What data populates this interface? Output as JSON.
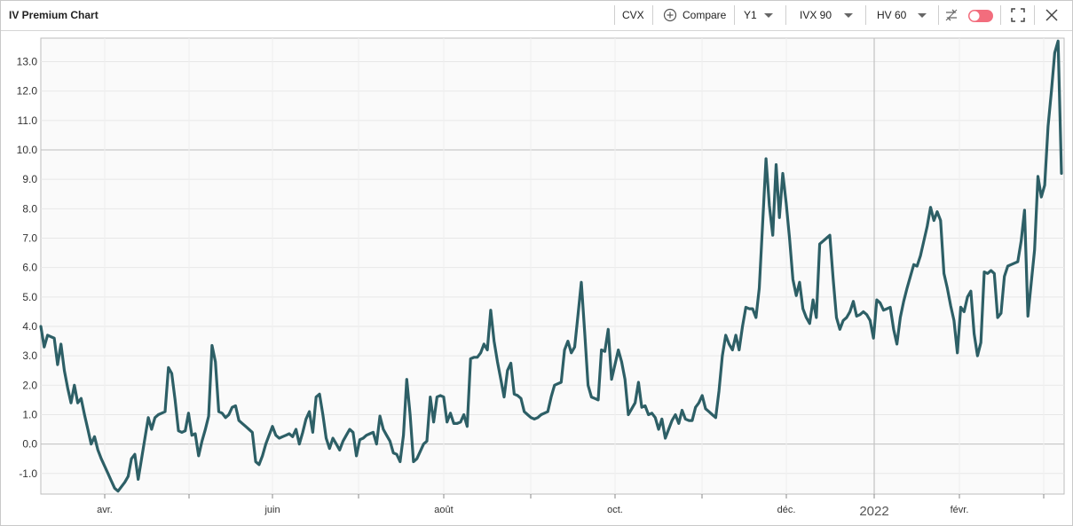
{
  "window": {
    "title": "IV Premium Chart"
  },
  "toolbar": {
    "symbol": "CVX",
    "compare_label": "Compare",
    "period": "Y1",
    "iv_measure": "IVX 90",
    "hv_measure": "HV 60",
    "toggle_color": "#f26d7d",
    "icons": [
      "plus-circle-icon",
      "chevron-down-icon",
      "swap-icon",
      "toggle-icon",
      "fullscreen-icon",
      "close-icon"
    ]
  },
  "chart_data": {
    "type": "line",
    "title": "",
    "xlabel": "",
    "ylabel": "",
    "ylim": [
      -1.7,
      13.8
    ],
    "grid": true,
    "x_tick_labels": [
      "avr.",
      "juin",
      "août",
      "oct.",
      "déc.",
      "2022",
      "févr."
    ],
    "y_tick_labels": [
      "-1.0",
      "0.0",
      "1.0",
      "2.0",
      "3.0",
      "4.0",
      "5.0",
      "6.0",
      "7.0",
      "8.0",
      "9.0",
      "10.0",
      "11.0",
      "12.0",
      "13.0"
    ],
    "series": [
      {
        "color": "#2d5f66",
        "values": [
          4.0,
          3.3,
          3.7,
          3.65,
          3.6,
          2.7,
          3.4,
          2.5,
          1.9,
          1.4,
          2.0,
          1.4,
          1.55,
          1.0,
          0.5,
          0.0,
          0.25,
          -0.2,
          -0.5,
          -0.75,
          -1.0,
          -1.25,
          -1.5,
          -1.6,
          -1.45,
          -1.3,
          -1.1,
          -0.5,
          -0.35,
          -1.2,
          -0.5,
          0.2,
          0.9,
          0.5,
          0.9,
          1.0,
          1.05,
          1.1,
          2.6,
          2.4,
          1.5,
          0.45,
          0.4,
          0.45,
          1.05,
          0.3,
          0.35,
          -0.4,
          0.1,
          0.5,
          0.95,
          3.35,
          2.8,
          1.1,
          1.05,
          0.9,
          1.0,
          1.25,
          1.3,
          0.8,
          0.7,
          0.6,
          0.5,
          0.4,
          -0.6,
          -0.7,
          -0.4,
          0.0,
          0.3,
          0.6,
          0.3,
          0.2,
          0.25,
          0.3,
          0.35,
          0.25,
          0.5,
          0.0,
          0.4,
          0.85,
          1.1,
          0.4,
          1.6,
          1.7,
          1.0,
          0.2,
          -0.15,
          0.2,
          0.0,
          -0.2,
          0.1,
          0.3,
          0.5,
          0.4,
          -0.4,
          0.15,
          0.2,
          0.3,
          0.35,
          0.4,
          0.0,
          0.95,
          0.5,
          0.3,
          0.1,
          -0.3,
          -0.35,
          -0.6,
          0.3,
          2.2,
          1.0,
          -0.6,
          -0.5,
          -0.25,
          0.0,
          0.1,
          1.6,
          0.75,
          1.6,
          1.65,
          1.6,
          0.75,
          1.05,
          0.7,
          0.7,
          0.75,
          1.0,
          0.6,
          2.9,
          2.95,
          2.95,
          3.1,
          3.4,
          3.2,
          4.55,
          3.5,
          2.8,
          2.2,
          1.6,
          2.5,
          2.75,
          1.7,
          1.65,
          1.55,
          1.1,
          1.0,
          0.9,
          0.85,
          0.9,
          1.0,
          1.05,
          1.1,
          1.6,
          2.0,
          2.05,
          2.1,
          3.2,
          3.5,
          3.1,
          3.3,
          4.4,
          5.5,
          3.8,
          2.0,
          1.6,
          1.55,
          1.5,
          3.2,
          3.15,
          3.9,
          2.2,
          2.7,
          3.2,
          2.8,
          2.2,
          1.0,
          1.2,
          1.4,
          2.1,
          1.25,
          1.3,
          1.0,
          1.05,
          0.9,
          0.5,
          0.85,
          0.2,
          0.5,
          0.8,
          1.0,
          0.7,
          1.15,
          0.85,
          0.8,
          0.8,
          1.25,
          1.4,
          1.65,
          1.2,
          1.1,
          1.0,
          0.9,
          1.8,
          3.0,
          3.7,
          3.4,
          3.2,
          3.7,
          3.2,
          4.0,
          4.65,
          4.6,
          4.6,
          4.3,
          5.3,
          7.5,
          9.7,
          8.1,
          7.1,
          9.5,
          7.7,
          9.2,
          8.2,
          7.0,
          5.6,
          5.05,
          5.5,
          4.6,
          4.3,
          4.1,
          4.9,
          4.3,
          6.8,
          6.9,
          7.0,
          7.1,
          5.6,
          4.3,
          3.9,
          4.2,
          4.3,
          4.5,
          4.85,
          4.35,
          4.4,
          4.5,
          4.4,
          4.2,
          3.6,
          4.9,
          4.8,
          4.55,
          4.6,
          4.65,
          3.9,
          3.4,
          4.3,
          4.85,
          5.3,
          5.7,
          6.1,
          6.05,
          6.4,
          6.9,
          7.4,
          8.05,
          7.6,
          7.9,
          7.6,
          5.8,
          5.3,
          4.7,
          4.2,
          3.1,
          4.65,
          4.5,
          5.0,
          5.2,
          3.75,
          3.0,
          3.45,
          5.85,
          5.8,
          5.9,
          5.8,
          4.3,
          4.45,
          5.7,
          6.05,
          6.1,
          6.15,
          6.2,
          6.9,
          7.95,
          4.35,
          5.5,
          6.6,
          9.1,
          8.4,
          8.8,
          10.8,
          12.0,
          13.3,
          13.7,
          9.2
        ]
      }
    ]
  }
}
